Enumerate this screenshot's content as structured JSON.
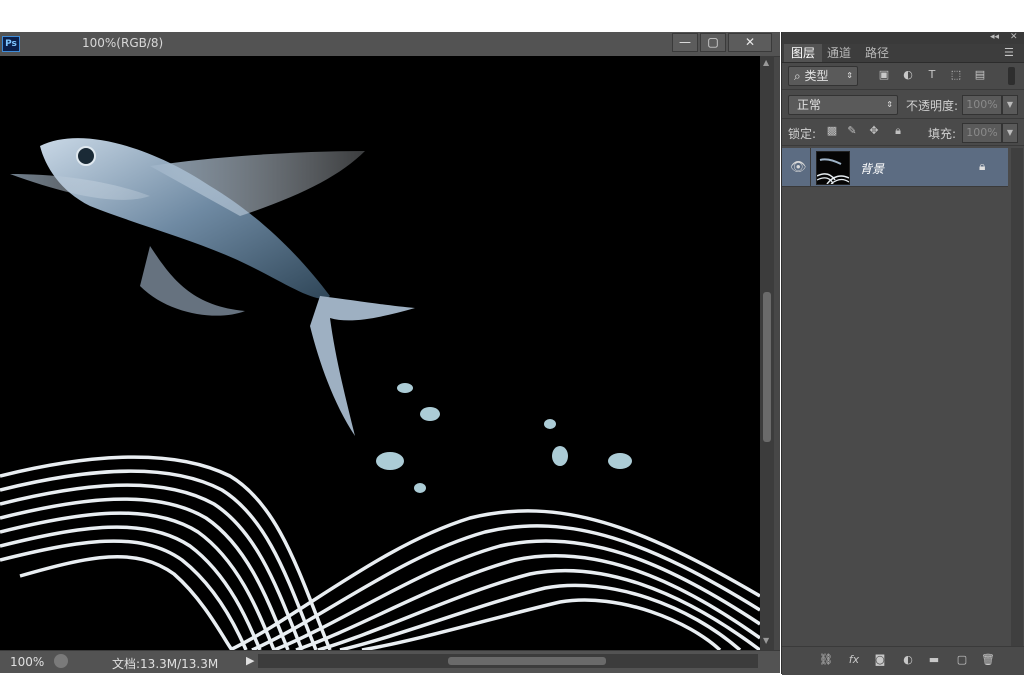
{
  "document": {
    "title": "100%(RGB/8)",
    "app_badge": "Ps",
    "window_buttons": {
      "minimize": "—",
      "maximize": "▢",
      "close": "✕"
    },
    "status": {
      "zoom": "100%",
      "doc_info": "文档:13.3M/13.3M",
      "arrow": "▶"
    }
  },
  "panel": {
    "tabs": [
      {
        "label": "图层",
        "active": true
      },
      {
        "label": "通道",
        "active": false
      },
      {
        "label": "路径",
        "active": false
      }
    ],
    "filter": {
      "label": "⌕ 类型"
    },
    "blend": {
      "mode": "正常",
      "opacity_label": "不透明度:",
      "opacity": "100%"
    },
    "lock": {
      "label": "锁定:",
      "fill_label": "填充:",
      "fill": "100%"
    },
    "layers": [
      {
        "name": "背景",
        "visible": true,
        "locked": true
      }
    ]
  },
  "colors": {
    "selected_layer": "#5c6c82",
    "panel_bg": "#4a4a4a",
    "canvas_bg": "#000000"
  }
}
